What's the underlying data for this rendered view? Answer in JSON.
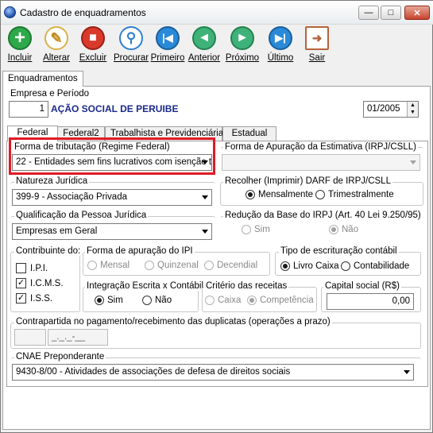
{
  "window": {
    "title": "Cadastro de enquadramentos"
  },
  "toolbar": {
    "incluir": "Incluir",
    "alterar": "Alterar",
    "excluir": "Excluir",
    "procurar": "Procurar",
    "primeiro": "Primeiro",
    "anterior": "Anterior",
    "proximo": "Próximo",
    "ultimo": "Último",
    "sair": "Sair"
  },
  "main_tab": "Enquadramentos",
  "empresa": {
    "group_label": "Empresa e Período",
    "code": "1",
    "name": "AÇÃO SOCIAL DE PERUIBE",
    "period": "01/2005"
  },
  "tabs": [
    "Federal",
    "Federal2",
    "Trabalhista e Previdenciária",
    "Estadual"
  ],
  "federal": {
    "forma_tributacao_label": "Forma de tributação (Regime Federal)",
    "forma_tributacao_value": "22 - Entidades sem fins lucrativos com isenção to",
    "forma_apuracao_estimativa_label": "Forma de Apuração da Estimativa (IRPJ/CSLL)",
    "forma_apuracao_estimativa_value": "",
    "natureza_label": "Natureza Jurídica",
    "natureza_value": "399-9 - Associação Privada",
    "recolher_label": "Recolher (Imprimir) DARF de IRPJ/CSLL",
    "recolher_options": [
      "Mensalmente",
      "Trimestralmente"
    ],
    "qualificacao_label": "Qualificação da Pessoa Jurídica",
    "qualificacao_value": "Empresas em Geral",
    "reducao_label": "Redução da Base do IRPJ (Art. 40 Lei 9.250/95)",
    "reducao_options": [
      "Sim",
      "Não"
    ],
    "contribuinte_label": "Contribuinte do:",
    "contribuinte_options": [
      "I.P.I.",
      "I.C.M.S.",
      "I.S.S."
    ],
    "apuracao_ipi_label": "Forma de apuração do IPI",
    "apuracao_ipi_options": [
      "Mensal",
      "Quinzenal",
      "Decendial"
    ],
    "escrituracao_label": "Tipo de escrituração contábil",
    "escrituracao_options": [
      "Livro Caixa",
      "Contabilidade"
    ],
    "integracao_label": "Integração Escrita x Contábil",
    "integracao_options": [
      "Sim",
      "Não"
    ],
    "criterio_label": "Critério das receitas",
    "criterio_options": [
      "Caixa",
      "Competência"
    ],
    "capital_label": "Capital social (R$)",
    "capital_value": "0,00",
    "contrapartida_label": "Contrapartida no pagamento/recebimento das duplicatas (operações a prazo)",
    "contrapartida_mask": "_._._-__",
    "cnae_label": "CNAE Preponderante",
    "cnae_value": "9430-8/00 - Atividades de associações de defesa de direitos sociais"
  }
}
